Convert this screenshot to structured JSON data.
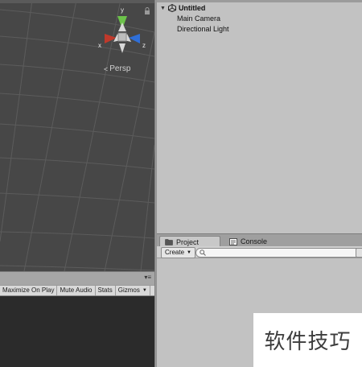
{
  "scene_view": {
    "camera_mode_label": "Persp",
    "gizmo_axes": [
      {
        "label": "y",
        "color": "#6cc24a"
      },
      {
        "label": "x",
        "color": "#c0392b"
      },
      {
        "label": "z",
        "color": "#2f6fd8"
      }
    ],
    "background": "#474747"
  },
  "game_view": {
    "toolbar": {
      "maximize_on_play": "Maximize On Play",
      "mute_audio": "Mute Audio",
      "stats": "Stats",
      "gizmos": "Gizmos"
    }
  },
  "hierarchy": {
    "scene_name": "Untitled",
    "items": [
      {
        "label": "Main Camera"
      },
      {
        "label": "Directional Light"
      }
    ]
  },
  "bottom_panel": {
    "tabs": [
      {
        "label": "Project",
        "icon": "folder-icon",
        "active": true
      },
      {
        "label": "Console",
        "icon": "console-icon",
        "active": false
      }
    ],
    "create_button": "Create",
    "search": {
      "value": "",
      "placeholder": ""
    }
  },
  "watermark": {
    "text": "软件技巧"
  }
}
